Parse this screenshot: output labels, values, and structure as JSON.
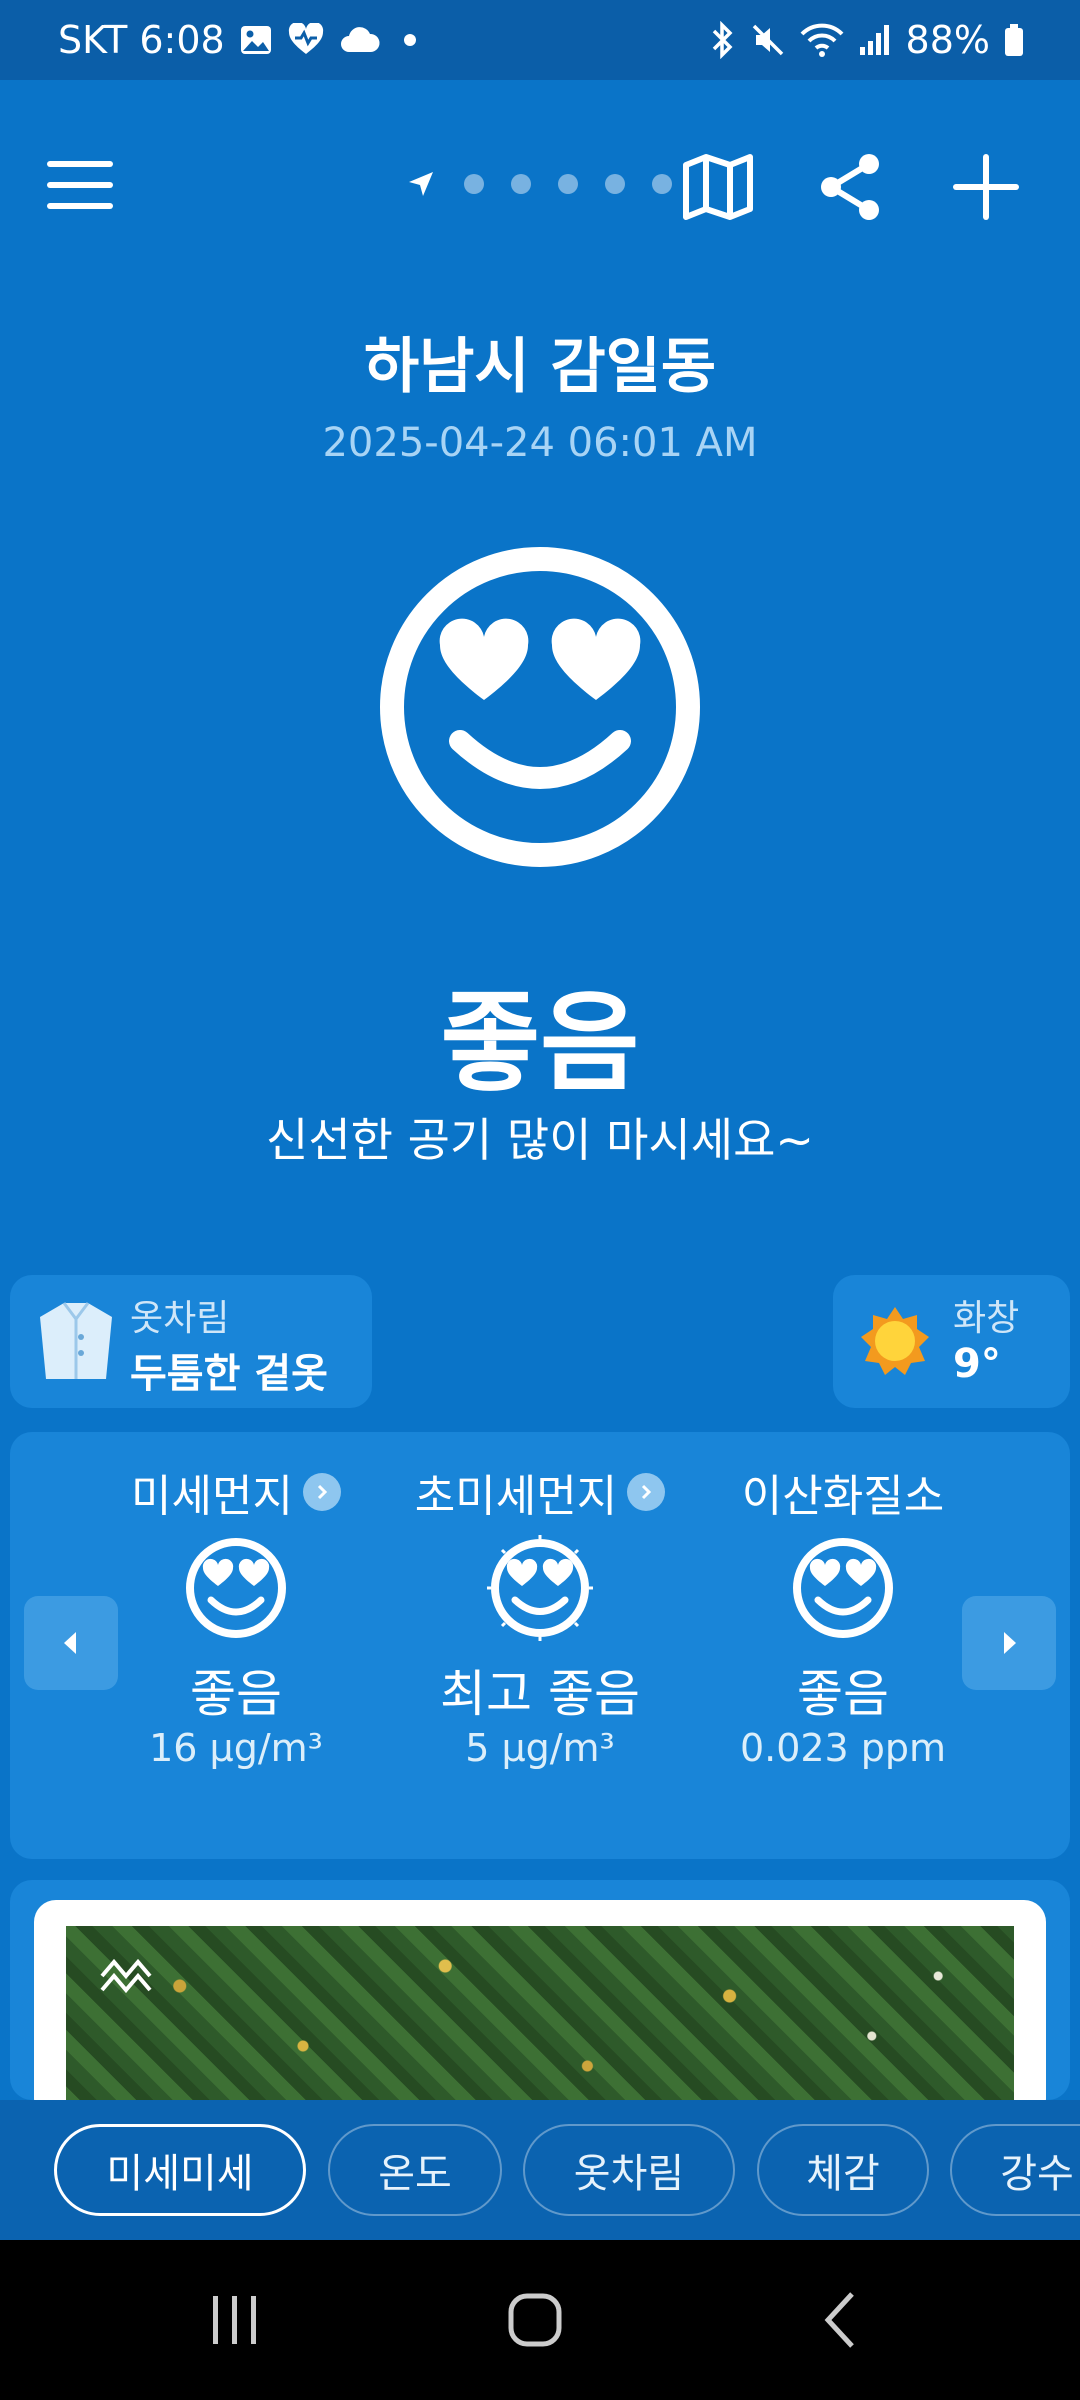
{
  "status_bar": {
    "carrier_time": "SKT 6:08",
    "battery": "88%"
  },
  "header": {
    "location": "하남시 감일동",
    "datetime": "2025-04-24 06:01 AM",
    "pager_dots": 5
  },
  "overall": {
    "status": "좋음",
    "message": "신선한 공기 많이 마시세요~"
  },
  "clothing": {
    "label": "옷차림",
    "value": "두툼한 겉옷"
  },
  "weather": {
    "condition": "화창",
    "temperature": "9°"
  },
  "air_quality": [
    {
      "name": "미세먼지",
      "status": "좋음",
      "value": "16 µg/m³",
      "has_detail": true
    },
    {
      "name": "초미세먼지",
      "status": "최고 좋음",
      "value": "5 µg/m³",
      "has_detail": true
    },
    {
      "name": "이산화질소",
      "status": "좋음",
      "value": "0.023 ppm",
      "has_detail": false
    }
  ],
  "tabs": [
    {
      "label": "미세미세",
      "active": true
    },
    {
      "label": "온도",
      "active": false
    },
    {
      "label": "옷차림",
      "active": false
    },
    {
      "label": "체감",
      "active": false
    },
    {
      "label": "강수",
      "active": false
    }
  ],
  "colors": {
    "background": "#0a74c8",
    "status_bar": "#0b5ea8",
    "card": "#1985d8",
    "tab_bar": "#0b63b0"
  }
}
